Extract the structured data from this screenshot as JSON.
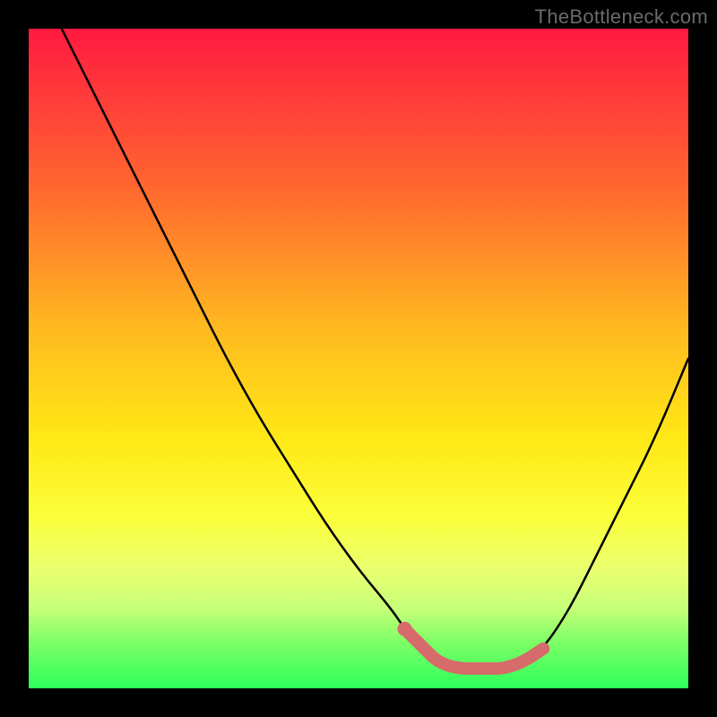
{
  "watermark": {
    "text": "TheBottleneck.com"
  },
  "chart_data": {
    "type": "line",
    "title": "",
    "xlabel": "",
    "ylabel": "",
    "xlim": [
      0,
      100
    ],
    "ylim": [
      0,
      100
    ],
    "grid": false,
    "legend": false,
    "series": [
      {
        "name": "bottleneck-curve",
        "color": "#000000",
        "x": [
          5,
          10,
          15,
          20,
          25,
          30,
          35,
          40,
          45,
          50,
          55,
          57,
          60,
          62,
          65,
          68,
          70,
          72,
          75,
          78,
          82,
          86,
          90,
          95,
          100
        ],
        "y": [
          100,
          90,
          80,
          70,
          60,
          50,
          41,
          33,
          25,
          18,
          12,
          9,
          6,
          4,
          3,
          3,
          3,
          3,
          4,
          6,
          12,
          20,
          28,
          38,
          50
        ]
      },
      {
        "name": "optimal-band-marker",
        "color": "#d76a6a",
        "x": [
          57,
          60,
          62,
          65,
          68,
          70,
          72,
          75,
          78
        ],
        "y": [
          9,
          6,
          4,
          3,
          3,
          3,
          3,
          4,
          6
        ]
      }
    ],
    "marker_endpoints": {
      "left": {
        "x": 57,
        "y": 9
      },
      "right": {
        "x": 78,
        "y": 6
      }
    }
  }
}
